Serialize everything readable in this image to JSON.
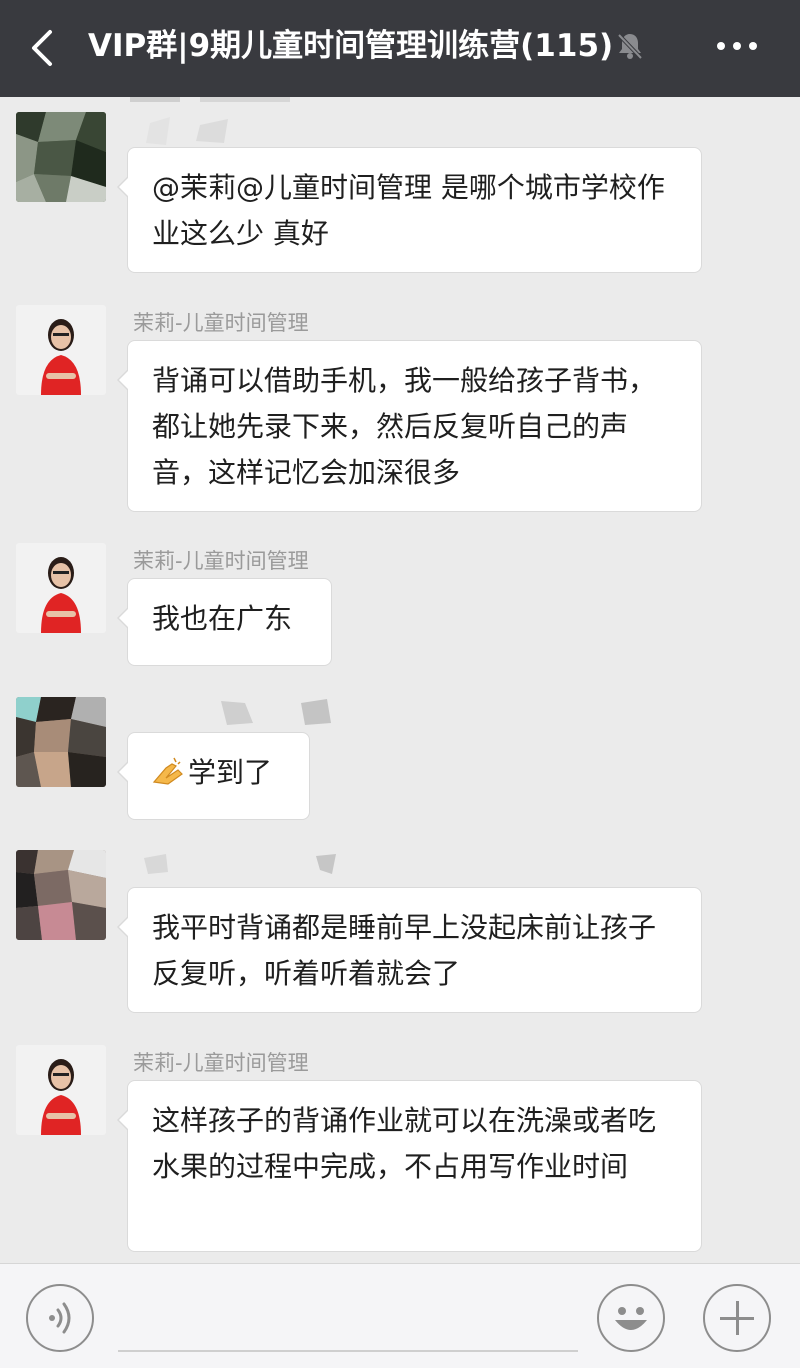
{
  "header": {
    "title": "VIP群|9期儿童时间管理训练营(115)",
    "back_icon": "chevron-left-icon",
    "mute_icon": "bell-muted-icon",
    "more_icon": "more-dots-icon"
  },
  "messages": [
    {
      "sender": "",
      "text": "@茉莉@儿童时间管理  是哪个城市学校作业这么少 真好"
    },
    {
      "sender": "茉莉-儿童时间管理",
      "text": "背诵可以借助手机，我一般给孩子背书，都让她先录下来，然后反复听自己的声音，这样记忆会加深很多"
    },
    {
      "sender": "茉莉-儿童时间管理",
      "text": "我也在广东"
    },
    {
      "sender": "",
      "emoji": "clapping-hands-emoji",
      "text": "学到了"
    },
    {
      "sender": "",
      "text": "我平时背诵都是睡前早上没起床前让孩子反复听，听着听着就会了"
    },
    {
      "sender": "茉莉-儿童时间管理",
      "text": "这样孩子的背诵作业就可以在洗澡或者吃水果的过程中完成，不占用写作业时间"
    }
  ],
  "input_bar": {
    "voice_icon": "voice-input-icon",
    "emoji_icon": "emoji-face-icon",
    "plus_icon": "plus-icon",
    "input_value": ""
  },
  "colors": {
    "header_bg": "#393a3f",
    "chat_bg": "#ebebeb",
    "bubble_bg": "#ffffff",
    "sender_name": "#9a9a9a"
  }
}
